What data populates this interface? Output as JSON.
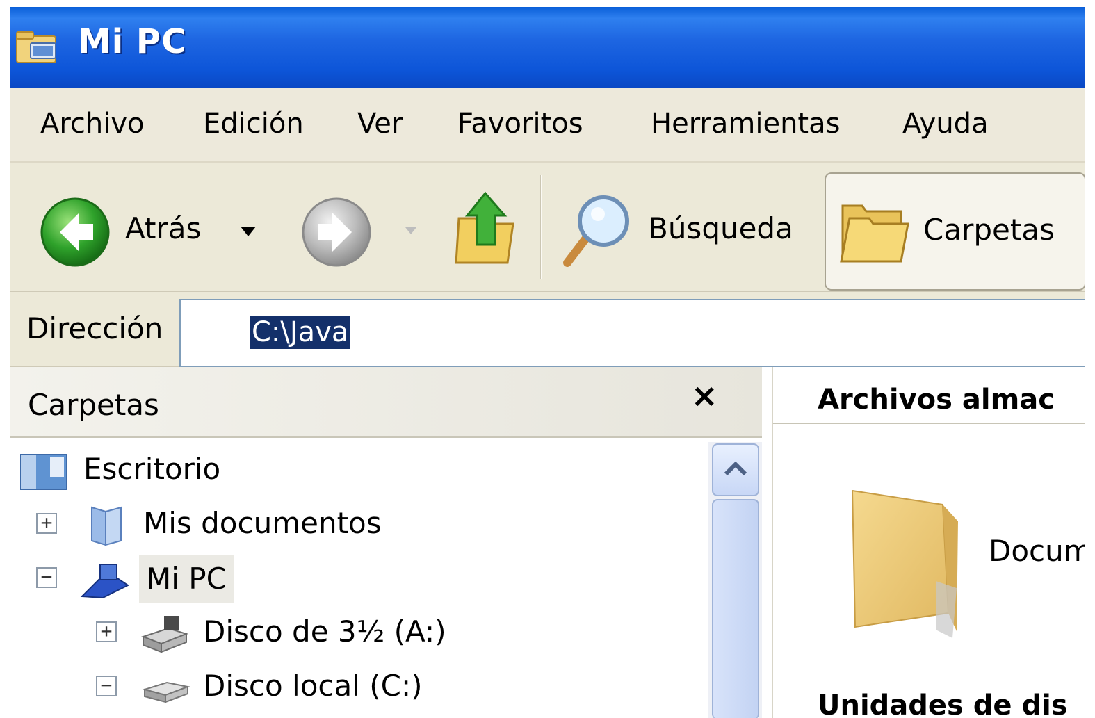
{
  "window": {
    "title": "Mi PC"
  },
  "menu": [
    "Archivo",
    "Edición",
    "Ver",
    "Favoritos",
    "Herramientas",
    "Ayuda"
  ],
  "toolbar": {
    "back_label": "Atrás",
    "search_label": "Búsqueda",
    "folders_label": "Carpetas"
  },
  "address": {
    "label": "Dirección",
    "value": "C:\\Java"
  },
  "folders_pane": {
    "title": "Carpetas",
    "close_glyph": "×",
    "tree": [
      {
        "label": "Escritorio",
        "expander": "",
        "icon": "desktop-icon"
      },
      {
        "label": "Mis documentos",
        "expander": "+",
        "icon": "my-documents-icon"
      },
      {
        "label": "Mi PC",
        "expander": "−",
        "icon": "my-computer-icon"
      },
      {
        "label": "Disco de 3½ (A:)",
        "expander": "+",
        "icon": "floppy-drive-icon"
      },
      {
        "label": "Disco local (C:)",
        "expander": "−",
        "icon": "hard-drive-icon"
      }
    ]
  },
  "content": {
    "section_files": "Archivos almac",
    "item_label": "Docum",
    "section_drives": "Unidades de dis"
  },
  "colors": {
    "titlebar": "#0d55d8",
    "menubar": "#ede9db",
    "selection": "#14306a"
  }
}
